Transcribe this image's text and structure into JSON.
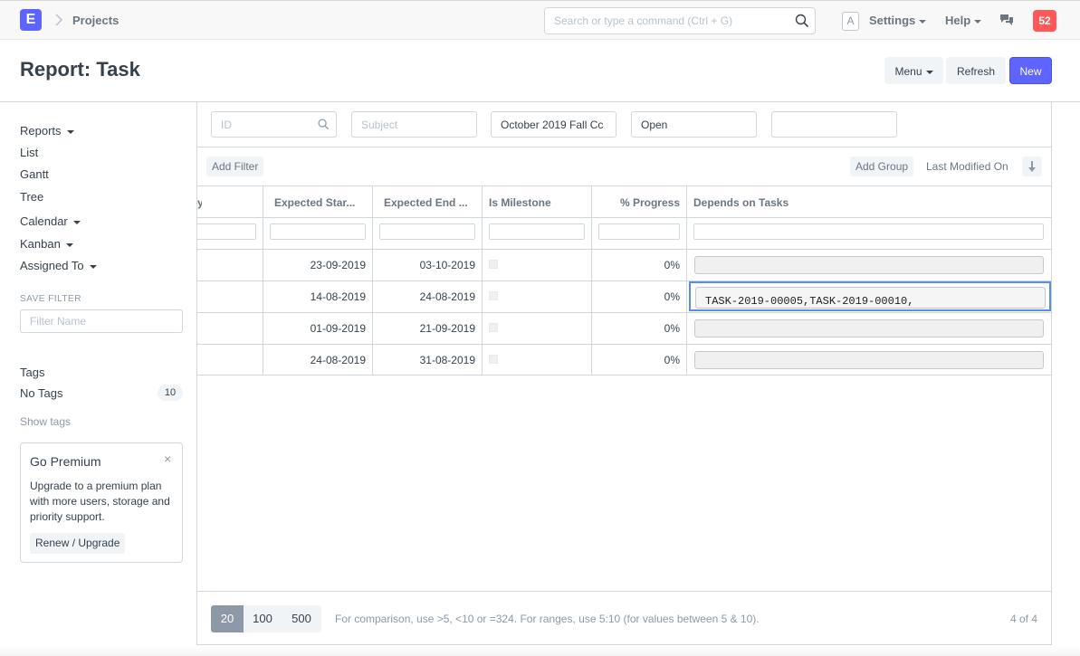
{
  "navbar": {
    "logo_letter": "E",
    "breadcrumb": "Projects",
    "search_placeholder": "Search or type a command (Ctrl + G)",
    "avatar_letter": "A",
    "settings_label": "Settings",
    "help_label": "Help",
    "notification_count": "52"
  },
  "page": {
    "title": "Report: Task",
    "menu_label": "Menu",
    "refresh_label": "Refresh",
    "new_label": "New"
  },
  "sidebar": {
    "items": [
      {
        "label": "Reports",
        "dropdown": true
      },
      {
        "label": "List",
        "dropdown": false
      },
      {
        "label": "Gantt",
        "dropdown": false
      },
      {
        "label": "Tree",
        "dropdown": false
      },
      {
        "label": "Calendar",
        "dropdown": true
      },
      {
        "label": "Kanban",
        "dropdown": true
      },
      {
        "label": "Assigned To",
        "dropdown": true
      }
    ],
    "save_filter_label": "SAVE FILTER",
    "filter_name_placeholder": "Filter Name",
    "tags_label": "Tags",
    "no_tags_label": "No Tags",
    "no_tags_count": "10",
    "show_tags_label": "Show tags",
    "premium": {
      "title": "Go Premium",
      "close": "×",
      "text": "Upgrade to a premium plan with more users, storage and priority support.",
      "button": "Renew / Upgrade"
    }
  },
  "filters": {
    "id_placeholder": "ID",
    "subject_placeholder": "Subject",
    "project_value": "October 2019 Fall Cc",
    "status_value": "Open",
    "extra_value": ""
  },
  "toolbar": {
    "add_filter": "Add Filter",
    "add_group": "Add Group",
    "sort_label": "Last Modified On"
  },
  "table": {
    "partial_header": "y",
    "headers": [
      "Expected Star...",
      "Expected End ...",
      "Is Milestone",
      "% Progress",
      "Depends on Tasks"
    ],
    "rows": [
      {
        "start": "23-09-2019",
        "end": "03-10-2019",
        "progress": "0%",
        "depends": ""
      },
      {
        "start": "14-08-2019",
        "end": "24-08-2019",
        "progress": "0%",
        "depends": "TASK-2019-00005,TASK-2019-00010,"
      },
      {
        "start": "01-09-2019",
        "end": "21-09-2019",
        "progress": "0%",
        "depends": ""
      },
      {
        "start": "24-08-2019",
        "end": "31-08-2019",
        "progress": "0%",
        "depends": ""
      }
    ]
  },
  "footer": {
    "page_sizes": [
      "20",
      "100",
      "500"
    ],
    "active_page_size": "20",
    "hint": "For comparison, use >5, <10 or =324. For ranges, use 5:10 (for values between 5 & 10).",
    "count": "4 of 4"
  }
}
